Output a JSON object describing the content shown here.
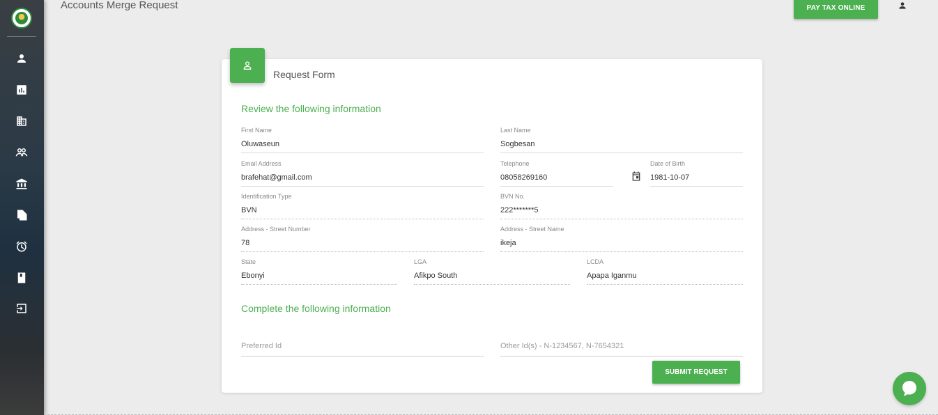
{
  "header": {
    "title": "Accounts Merge Request",
    "pay_button": "PAY TAX ONLINE"
  },
  "sidebar": {
    "items": [
      {
        "icon": "person-icon"
      },
      {
        "icon": "chart-icon"
      },
      {
        "icon": "building-icon"
      },
      {
        "icon": "group-icon"
      },
      {
        "icon": "bank-icon"
      },
      {
        "icon": "documents-icon"
      },
      {
        "icon": "alarm-icon"
      },
      {
        "icon": "book-icon"
      },
      {
        "icon": "logout-icon"
      }
    ]
  },
  "card": {
    "title": "Request Form",
    "review_title": "Review the following information",
    "complete_title": "Complete the following information",
    "fields": {
      "first_name": {
        "label": "First Name",
        "value": "Oluwaseun"
      },
      "last_name": {
        "label": "Last Name",
        "value": "Sogbesan"
      },
      "email": {
        "label": "Email Address",
        "value": "brafehat@gmail.com"
      },
      "telephone": {
        "label": "Telephone",
        "value": "08058269160"
      },
      "dob": {
        "label": "Date of Birth",
        "value": "1981-10-07"
      },
      "id_type": {
        "label": "Identification Type",
        "value": "BVN"
      },
      "bvn": {
        "label": "BVN No.",
        "value": "222*******5"
      },
      "street_number": {
        "label": "Address - Street Number",
        "value": "78"
      },
      "street_name": {
        "label": "Address - Street Name",
        "value": "ikeja"
      },
      "state": {
        "label": "State",
        "value": "Ebonyi"
      },
      "lga": {
        "label": "LGA",
        "value": "Afikpo South"
      },
      "lcda": {
        "label": "LCDA",
        "value": "Apapa Iganmu"
      }
    },
    "preferred_id": {
      "placeholder": "Preferred Id",
      "value": ""
    },
    "other_ids": {
      "placeholder": "Other Id(s) - N-1234567, N-7654321",
      "value": ""
    },
    "submit_button": "SUBMIT REQUEST"
  },
  "colors": {
    "accent": "#4caf50",
    "sidebar": "#2a3a46",
    "background": "#ececec"
  }
}
